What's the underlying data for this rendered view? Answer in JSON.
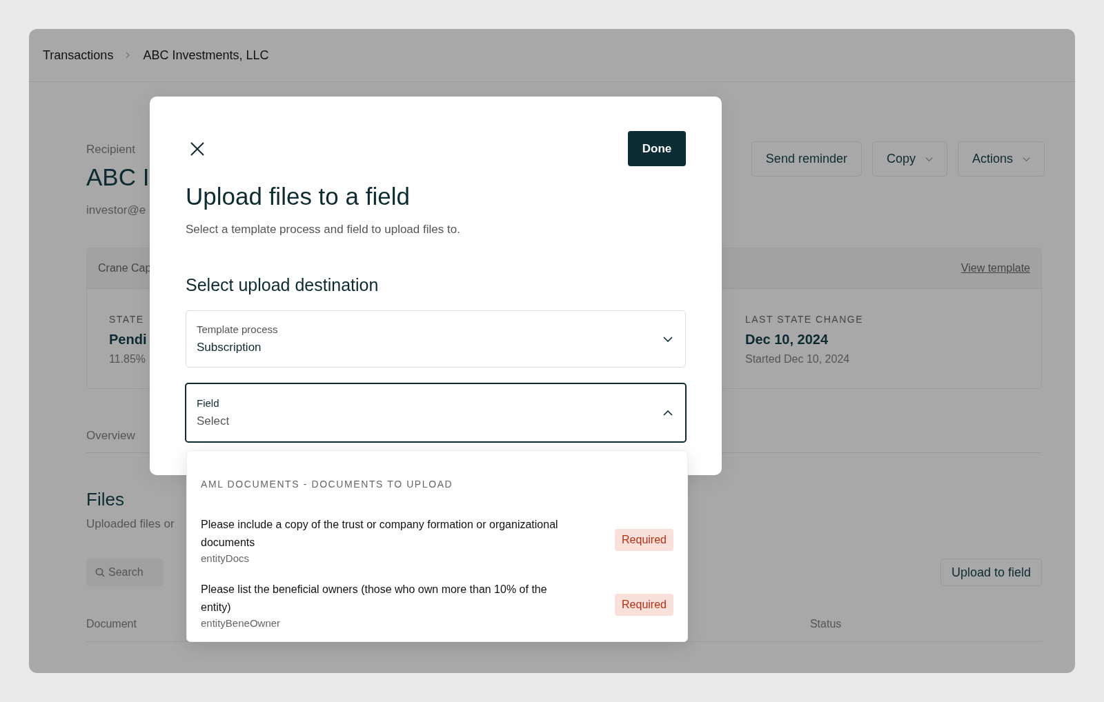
{
  "breadcrumb": [
    {
      "label": "Transactions"
    },
    {
      "label": "ABC Investments, LLC"
    }
  ],
  "recipient": {
    "label": "Recipient",
    "name": "ABC I",
    "email": "investor@e"
  },
  "header_buttons": [
    {
      "label": "Send reminder",
      "kind": "plain"
    },
    {
      "label": "Copy",
      "kind": "menu"
    },
    {
      "label": "Actions",
      "kind": "menu"
    }
  ],
  "process_card": {
    "title": "Crane Cap",
    "link": "View template",
    "stats": [
      {
        "label": "STATE",
        "value": "Pendi",
        "detail": "11.85%"
      },
      {
        "label": "LAST STATE CHANGE",
        "value": "Dec 10, 2024",
        "detail": "Started Dec 10, 2024"
      }
    ]
  },
  "tabs": [
    {
      "label": "Overview",
      "selected": false
    }
  ],
  "files": {
    "title": "Files",
    "subtitle": "Uploaded files or",
    "search": {
      "placeholder": "Search"
    },
    "upload_button": "Upload to field",
    "columns": [
      "Document",
      "Status"
    ]
  },
  "modal": {
    "done": "Done",
    "title": "Upload files to a field",
    "subtitle": "Select a template process and field to upload files to.",
    "section": "Select upload destination",
    "fields": [
      {
        "label": "Template process",
        "value": "Subscription",
        "expanded": false
      },
      {
        "label": "Field",
        "placeholder": "Select",
        "expanded": true
      }
    ],
    "dropdown": {
      "group": "AML DOCUMENTS - DOCUMENTS TO UPLOAD",
      "options": [
        {
          "title": "Please include a copy of the trust or company formation or organizational documents",
          "key": "entityDocs",
          "badge": "Required"
        },
        {
          "title": "Please list the beneficial owners (those who own more than 10% of the entity)",
          "key": "entityBeneOwner",
          "badge": "Required"
        }
      ]
    }
  }
}
